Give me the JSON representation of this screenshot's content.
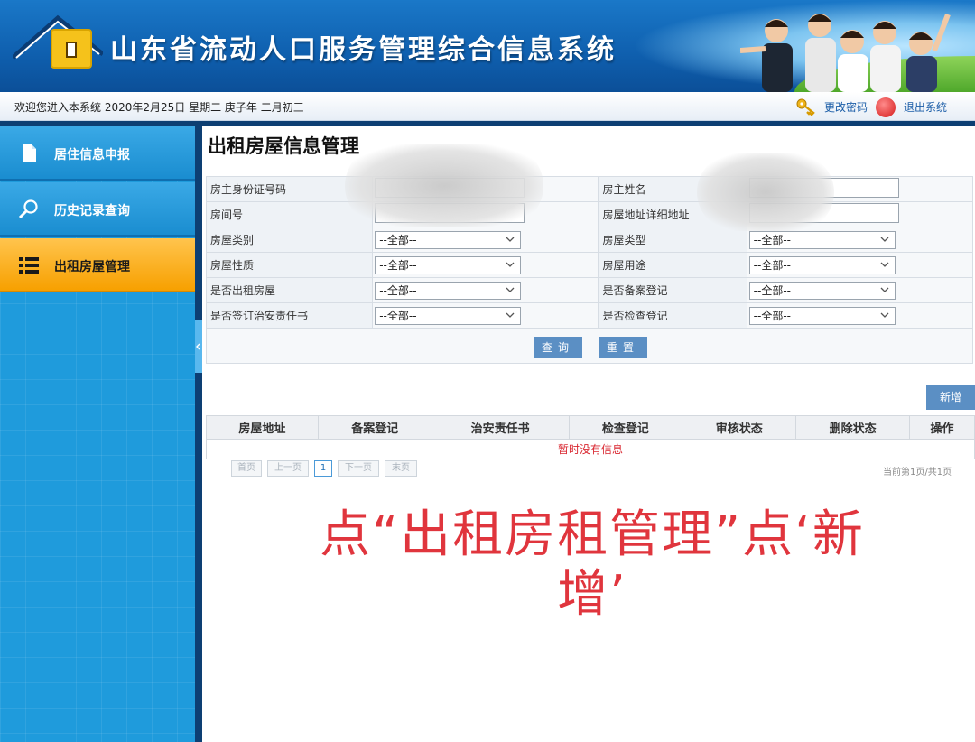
{
  "header": {
    "title": "山东省流动人口服务管理综合信息系统"
  },
  "subbar": {
    "welcome": "欢迎您进入本系统 2020年2月25日 星期二 庚子年 二月初三",
    "change_password": "更改密码",
    "exit": "退出系统"
  },
  "sidebar": {
    "items": [
      {
        "label": "居住信息申报",
        "icon": "document-icon"
      },
      {
        "label": "历史记录查询",
        "icon": "search-icon"
      },
      {
        "label": "出租房屋管理",
        "icon": "list-icon"
      }
    ]
  },
  "main": {
    "title": "出租房屋信息管理",
    "form": {
      "landlord_id_label": "房主身份证号码",
      "landlord_name_label": "房主姓名",
      "room_no_label": "房间号",
      "address_label": "房屋地址详细地址",
      "house_category_label": "房屋类别",
      "house_type_label": "房屋类型",
      "house_nature_label": "房屋性质",
      "house_usage_label": "房屋用途",
      "is_rental_label": "是否出租房屋",
      "is_filed_label": "是否备案登记",
      "is_security_label": "是否签订治安责任书",
      "is_inspected_label": "是否检查登记",
      "select_all": "--全部--"
    },
    "buttons": {
      "query": "查询",
      "reset": "重置",
      "add": "新增"
    },
    "table": {
      "headers": [
        "房屋地址",
        "备案登记",
        "治安责任书",
        "检查登记",
        "审核状态",
        "删除状态",
        "操作"
      ],
      "empty_message": "暂时没有信息"
    },
    "pager": {
      "first": "首页",
      "prev": "上一页",
      "current": "1",
      "next": "下一页",
      "last": "末页",
      "info": "当前第1页/共1页"
    },
    "overlay_text_line1": "点“出租房租管理”点‘新",
    "overlay_text_line2": "增’"
  },
  "colors": {
    "header_blue": "#0f5fae",
    "sidebar_blue": "#1f9bdc",
    "active_orange": "#f7a000",
    "button_blue": "#5b8fc4",
    "overlay_red": "#e0353d"
  }
}
